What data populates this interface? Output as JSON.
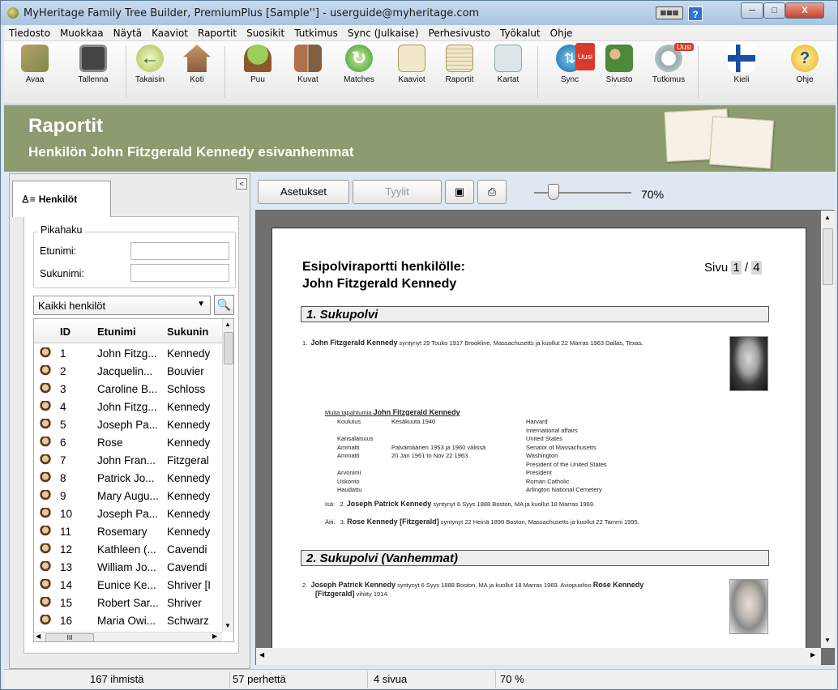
{
  "window": {
    "title": "MyHeritage Family Tree Builder, PremiumPlus [Sample''] - userguide@myheritage.com",
    "controls": {
      "minimize": "─",
      "maximize": "□",
      "close": "X"
    },
    "help": "?"
  },
  "menu": [
    "Tiedosto",
    "Muokkaa",
    "Näytä",
    "Kaaviot",
    "Raportit",
    "Suosikit",
    "Tutkimus",
    "Sync (Julkaise)",
    "Perhesivusto",
    "Työkalut",
    "Ohje"
  ],
  "toolbar": {
    "avaa": "Avaa",
    "tallenna": "Tallenna",
    "takaisin": "Takaisin",
    "koti": "Koti",
    "puu": "Puu",
    "kuvat": "Kuvat",
    "matches": "Matches",
    "kaaviot": "Kaaviot",
    "raportit": "Raportit",
    "kartat": "Kartat",
    "sync": "Sync",
    "sivusto": "Sivusto",
    "tutkimus": "Tutkimus",
    "kieli": "Kieli",
    "ohje": "Ohje",
    "badge": "Uusi"
  },
  "header": {
    "title": "Raportit",
    "subtitle": "Henkilön John Fitzgerald Kennedy esivanhemmat"
  },
  "leftpanel": {
    "tab": "Henkilöt",
    "quicksearch": "Pikahaku",
    "firstname_label": "Etunimi:",
    "lastname_label": "Sukunimi:",
    "filter": "Kaikki henkilöt",
    "columns": {
      "id": "ID",
      "first": "Etunimi",
      "last": "Sukunin"
    },
    "rows": [
      {
        "id": "1",
        "first": "John Fitzg...",
        "last": "Kennedy"
      },
      {
        "id": "2",
        "first": "Jacquelin...",
        "last": "Bouvier"
      },
      {
        "id": "3",
        "first": "Caroline B...",
        "last": "Schloss"
      },
      {
        "id": "4",
        "first": "John Fitzg...",
        "last": "Kennedy"
      },
      {
        "id": "5",
        "first": "Joseph Pa...",
        "last": "Kennedy"
      },
      {
        "id": "6",
        "first": "Rose",
        "last": "Kennedy"
      },
      {
        "id": "7",
        "first": "John Fran...",
        "last": "Fitzgeral"
      },
      {
        "id": "8",
        "first": "Patrick Jo...",
        "last": "Kennedy"
      },
      {
        "id": "9",
        "first": "Mary Augu...",
        "last": "Kennedy"
      },
      {
        "id": "10",
        "first": "Joseph Pa...",
        "last": "Kennedy"
      },
      {
        "id": "11",
        "first": "Rosemary",
        "last": "Kennedy"
      },
      {
        "id": "12",
        "first": "Kathleen (...",
        "last": "Cavendi"
      },
      {
        "id": "13",
        "first": "William Jo...",
        "last": "Cavendi"
      },
      {
        "id": "14",
        "first": "Eunice Ke...",
        "last": "Shriver [I"
      },
      {
        "id": "15",
        "first": "Robert Sar...",
        "last": "Shriver"
      },
      {
        "id": "16",
        "first": "Maria Owi...",
        "last": "Schwarz"
      }
    ]
  },
  "reportbar": {
    "settings": "Asetukset",
    "styles": "Tyylit",
    "zoom": "70%",
    "zoom_level": 0.2
  },
  "report": {
    "title": "Esipolviraportti henkilölle:",
    "person": "John Fitzgerald Kennedy",
    "page_label": "Sivu",
    "page_current": "1",
    "page_sep": "/",
    "page_total": "4",
    "gen1": "1. Sukupolvi",
    "gen1_entry_num": "1.",
    "gen1_entry_name": "John Fitzgerald Kennedy",
    "gen1_entry_text": "syntynyt 29 Touko 1917 Brookline, Massachusetts ja kuollut 22 Marras 1963 Dallas, Texas.",
    "events_title": "Muita tapahtumia",
    "events_name": "John Fitzgerald Kennedy",
    "events": [
      {
        "type": "Koulutus",
        "date": "Kesäkuuta 1940",
        "place": "Harvard"
      },
      {
        "type": "",
        "date": "",
        "place": "International affairs"
      },
      {
        "type": "Kansalaisuus",
        "date": "",
        "place": "United States"
      },
      {
        "type": "Ammatti",
        "date": "Palvämäärien 1953 ja 1960 välissä",
        "place": "Senator of Massachusetts"
      },
      {
        "type": "Ammatti",
        "date": "20 Jan 1961 to Nov 22 1963",
        "place": "Washington"
      },
      {
        "type": "",
        "date": "",
        "place": "President of the United States"
      },
      {
        "type": "Arvonimi",
        "date": "",
        "place": "President"
      },
      {
        "type": "Uskonto",
        "date": "",
        "place": "Roman Catholic"
      },
      {
        "type": "Haudattu",
        "date": "",
        "place": "Arlington National Cemetery"
      }
    ],
    "father_label": "Isä:",
    "father_num": "2.",
    "father_name": "Joseph Patrick Kennedy",
    "father_text": "syntynyt 6 Syys 1888 Boston, MA ja kuollut 18 Marras 1969.",
    "mother_label": "Äiti:",
    "mother_num": "3.",
    "mother_name": "Rose Kennedy [Fitzgerald]",
    "mother_text": "syntynyt 22 Heinä 1890 Boston, Massachusetts ja kuollut 22 Tammi 1995.",
    "gen2": "2. Sukupolvi (Vanhemmat)",
    "gen2_entry_num": "2.",
    "gen2_entry_name": "Joseph Patrick Kennedy",
    "gen2_entry_text": "syntynyt 6 Syys 1888 Boston, MA ja kuollut 18 Marras 1969. Aviopuoliso",
    "gen2_entry_spouse": "Rose Kennedy",
    "gen2_entry_spouse2": "[Fitzgerald]",
    "gen2_entry_end": "vihitty 1914."
  },
  "statusbar": {
    "people": "167 ihmistä",
    "families": "57 perhettä",
    "pages": "4 sivua",
    "zoom": "70 %"
  },
  "colors": {
    "header": "#8c9b70",
    "badge": "#d93a2a"
  }
}
